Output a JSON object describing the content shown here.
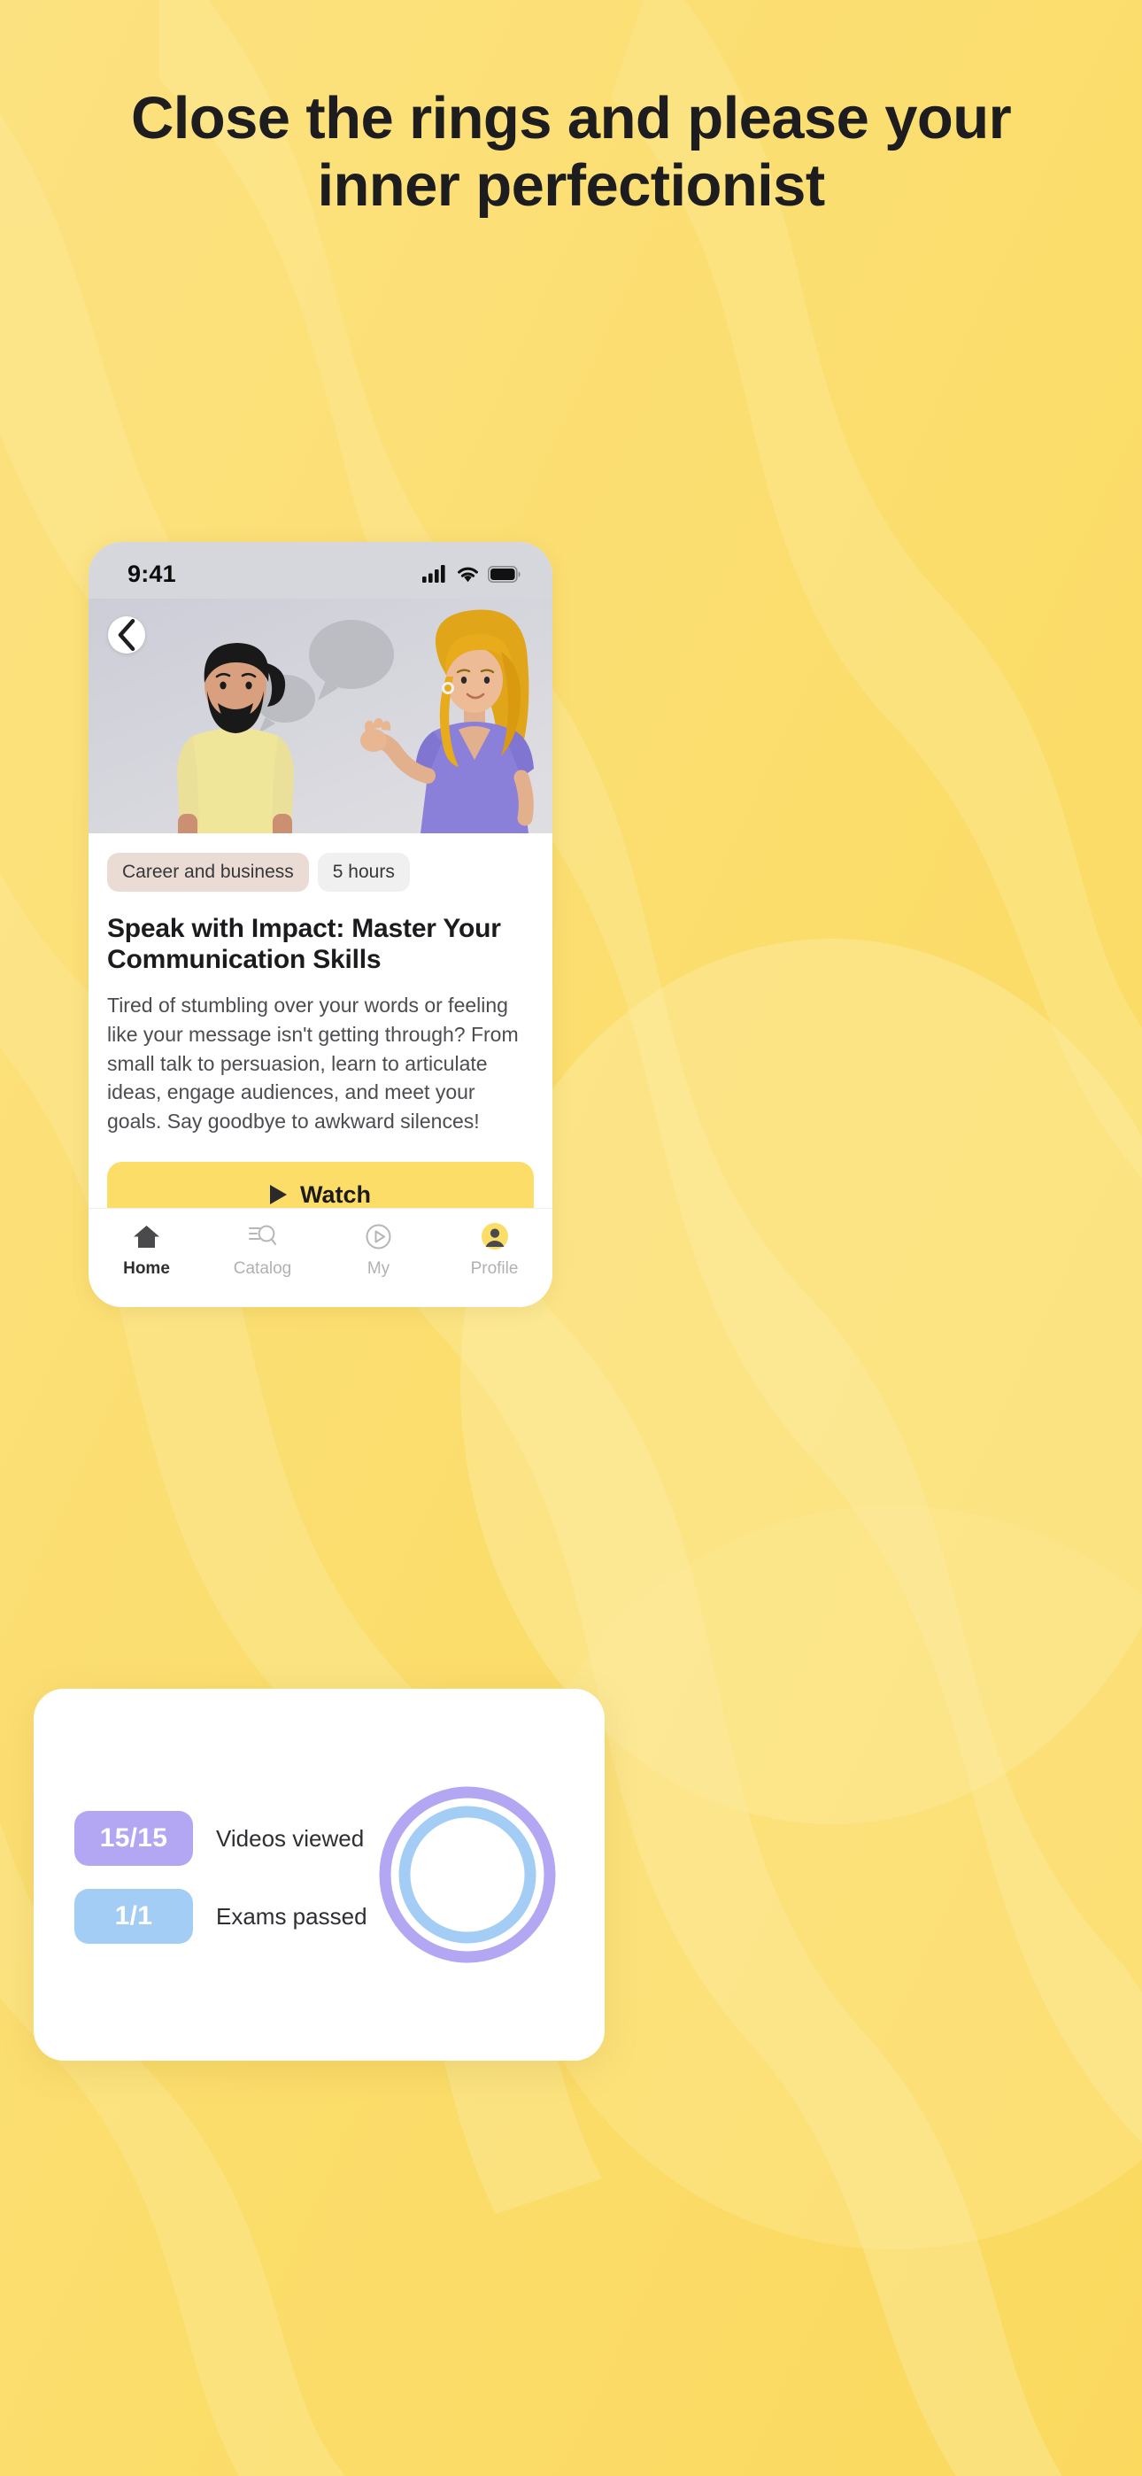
{
  "headline": "Close the rings and please your inner perfectionist",
  "theme": {
    "background": "#fbdf6e",
    "accent": "#fbdd67",
    "ring_outer": "#b3a6f2",
    "ring_inner": "#a4cdf6",
    "text_dark": "#1d1d1f"
  },
  "phone": {
    "statusbar": {
      "time": "9:41",
      "icons": [
        "cellular-signal-icon",
        "wifi-icon",
        "battery-icon"
      ]
    },
    "hero": {
      "back_icon": "chevron-left-icon",
      "alt": "illustration-two-people-talking-speech-bubbles"
    },
    "course": {
      "tags": [
        {
          "label": "Career and business",
          "style": "category"
        },
        {
          "label": "5 hours",
          "style": "duration"
        }
      ],
      "title": "Speak with Impact: Master Your Communication Skills",
      "description": "Tired of stumbling over your words or feeling like your message isn't getting through? From small talk to persuasion, learn to articulate ideas, engage audiences, and meet your goals. Say goodbye to awkward silences!",
      "watch_button": {
        "label": "Watch",
        "icon": "play-icon"
      }
    },
    "tabbar": {
      "items": [
        {
          "label": "Home",
          "icon": "home-icon",
          "active": true
        },
        {
          "label": "Catalog",
          "icon": "catalog-search-icon",
          "active": false
        },
        {
          "label": "My",
          "icon": "play-circle-icon",
          "active": false
        },
        {
          "label": "Profile",
          "icon": "profile-avatar-icon",
          "active": false
        }
      ]
    }
  },
  "progress_card": {
    "stats": [
      {
        "value": "15/15",
        "label": "Videos viewed",
        "color": "#b3a6f2"
      },
      {
        "value": "1/1",
        "label": "Exams passed",
        "color": "#a4cdf6"
      }
    ],
    "rings": {
      "outer": {
        "color": "#b3a6f2",
        "progress": 100
      },
      "inner": {
        "color": "#a4cdf6",
        "progress": 100
      }
    }
  }
}
